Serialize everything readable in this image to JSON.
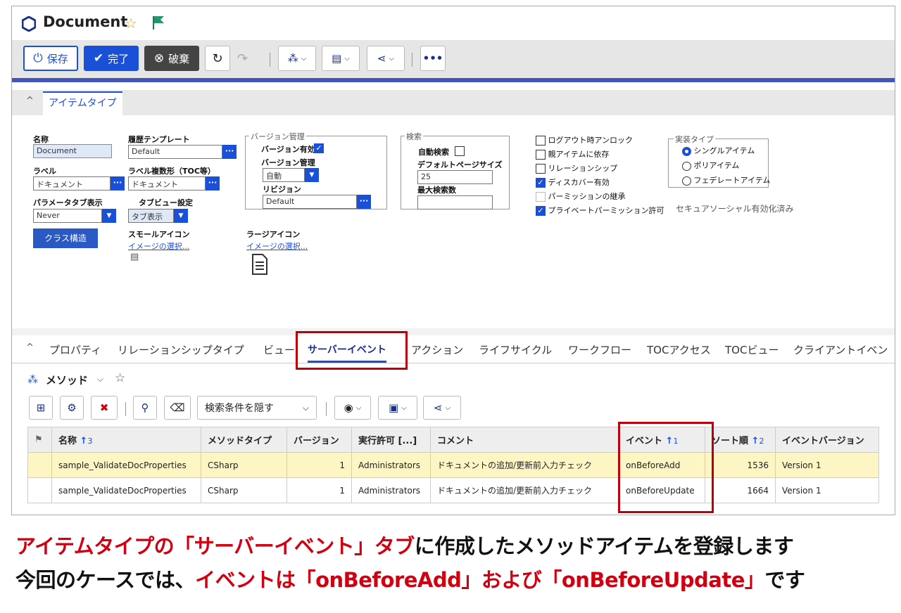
{
  "window": {
    "title": "Document"
  },
  "toolbar": {
    "save": "保存",
    "done": "完了",
    "discard": "破棄"
  },
  "section": {
    "tab": "アイテムタイプ"
  },
  "form": {
    "name_label": "名称",
    "name_value": "Document",
    "history_label": "履歴テンプレート",
    "history_value": "Default",
    "label_label": "ラベル",
    "label_value": "ドキュメント",
    "plural_label": "ラベル複数形（TOC等）",
    "plural_value": "ドキュメント",
    "param_tab_label": "パラメータタブ表示",
    "param_tab_value": "Never",
    "tabview_label": "タブビュー設定",
    "tabview_value": "タブ表示",
    "class_button": "クラス構造",
    "small_icon_label": "スモールアイコン",
    "small_icon_link": "イメージの選択...",
    "large_icon_label": "ラージアイコン",
    "large_icon_link": "イメージの選択...",
    "version": {
      "legend": "バージョン管理",
      "enabled_label": "バージョン有効",
      "control_label": "バージョン管理",
      "control_value": "自動",
      "revision_label": "リビジョン",
      "revision_value": "Default"
    },
    "search": {
      "legend": "検索",
      "auto_label": "自動検索",
      "page_size_label": "デフォルトページサイズ",
      "page_size_value": "25",
      "max_label": "最大検索数",
      "max_value": ""
    },
    "checks": [
      {
        "label": "ログアウト時アンロック",
        "checked": false
      },
      {
        "label": "親アイテムに依存",
        "checked": false
      },
      {
        "label": "リレーションシップ",
        "checked": false
      },
      {
        "label": "ディスカバー有効",
        "checked": true
      },
      {
        "label": "パーミッションの継承",
        "checked": false
      },
      {
        "label": "プライベートパーミッション許可",
        "checked": true
      }
    ],
    "impl": {
      "legend": "実装タイプ",
      "options": [
        "シングルアイテム",
        "ポリアイテム",
        "フェデレートアイテム"
      ],
      "selected": "シングルアイテム"
    },
    "secure_social": "セキュアソーシャル有効化済み"
  },
  "tabs": [
    "プロパティ",
    "リレーションシップタイプ",
    "ビュー",
    "サーバーイベント",
    "アクション",
    "ライフサイクル",
    "ワークフロー",
    "TOCアクセス",
    "TOCビュー",
    "クライアントイベン"
  ],
  "active_tab": "サーバーイベント",
  "grid": {
    "title": "メソッド",
    "search_toggle": "検索条件を隠す",
    "columns": [
      "",
      "名称",
      "メソッドタイプ",
      "バージョン",
      "実行許可 [...]",
      "コメント",
      "イベント",
      "ソート順",
      "イベントバージョン"
    ],
    "sort": {
      "name": "3",
      "event": "1",
      "order": "2"
    },
    "rows": [
      {
        "name": "sample_ValidateDocProperties",
        "type": "CSharp",
        "version": "1",
        "permission": "Administrators",
        "comment": "ドキュメントの追加/更新前入力チェック",
        "event": "onBeforeAdd",
        "order": "1536",
        "event_version": "Version 1"
      },
      {
        "name": "sample_ValidateDocProperties",
        "type": "CSharp",
        "version": "1",
        "permission": "Administrators",
        "comment": "ドキュメントの追加/更新前入力チェック",
        "event": "onBeforeUpdate",
        "order": "1664",
        "event_version": "Version 1"
      }
    ]
  },
  "caption": {
    "line1": [
      {
        "text": "アイテムタイプの「サーバーイベント」タブ",
        "color": "#d10010"
      },
      {
        "text": "に作成したメソッドアイテムを登録します",
        "color": "#111111"
      }
    ],
    "line2": [
      {
        "text": "今回のケースでは、",
        "color": "#111111"
      },
      {
        "text": "イベントは「onBeforeAdd」および「onBeforeUpdate」",
        "color": "#d10010"
      },
      {
        "text": "です",
        "color": "#111111"
      }
    ]
  }
}
